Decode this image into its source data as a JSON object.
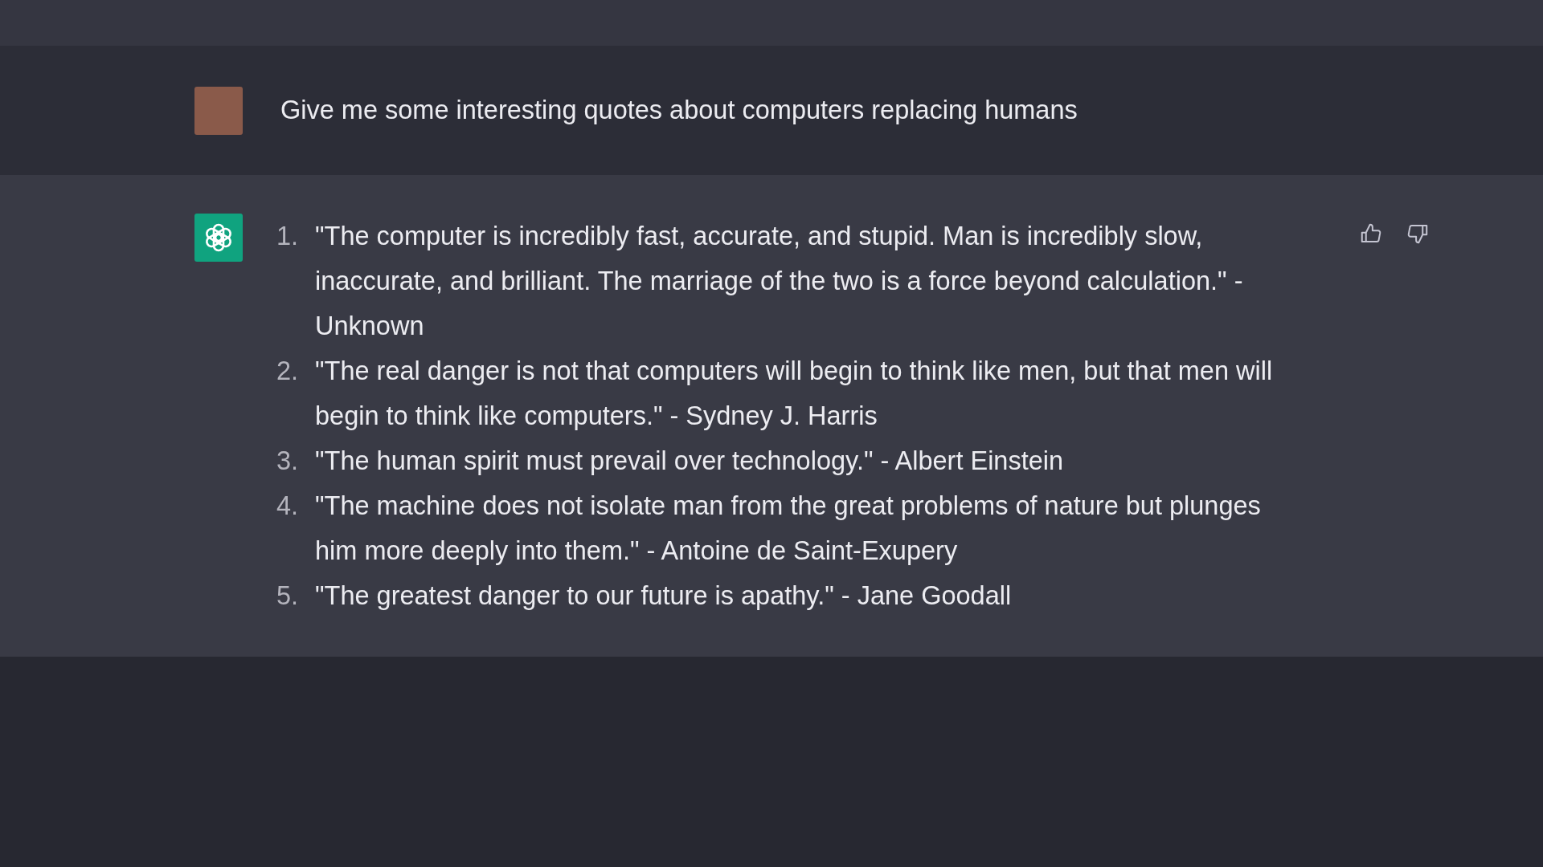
{
  "prompt": {
    "text": "Give me some interesting quotes about computers replacing humans"
  },
  "response": {
    "items": [
      {
        "number": "1.",
        "text": "\"The computer is incredibly fast, accurate, and stupid. Man is incredibly slow, inaccurate, and brilliant. The marriage of the two is a force beyond calculation.\" - Unknown"
      },
      {
        "number": "2.",
        "text": "\"The real danger is not that computers will begin to think like men, but that men will begin to think like computers.\" - Sydney J. Harris"
      },
      {
        "number": "3.",
        "text": "\"The human spirit must prevail over technology.\" - Albert Einstein"
      },
      {
        "number": "4.",
        "text": "\"The machine does not isolate man from the great problems of nature but plunges him more deeply into them.\" - Antoine de Saint-Exupery"
      },
      {
        "number": "5.",
        "text": "\"The greatest danger to our future is apathy.\" - Jane Goodall"
      }
    ]
  }
}
